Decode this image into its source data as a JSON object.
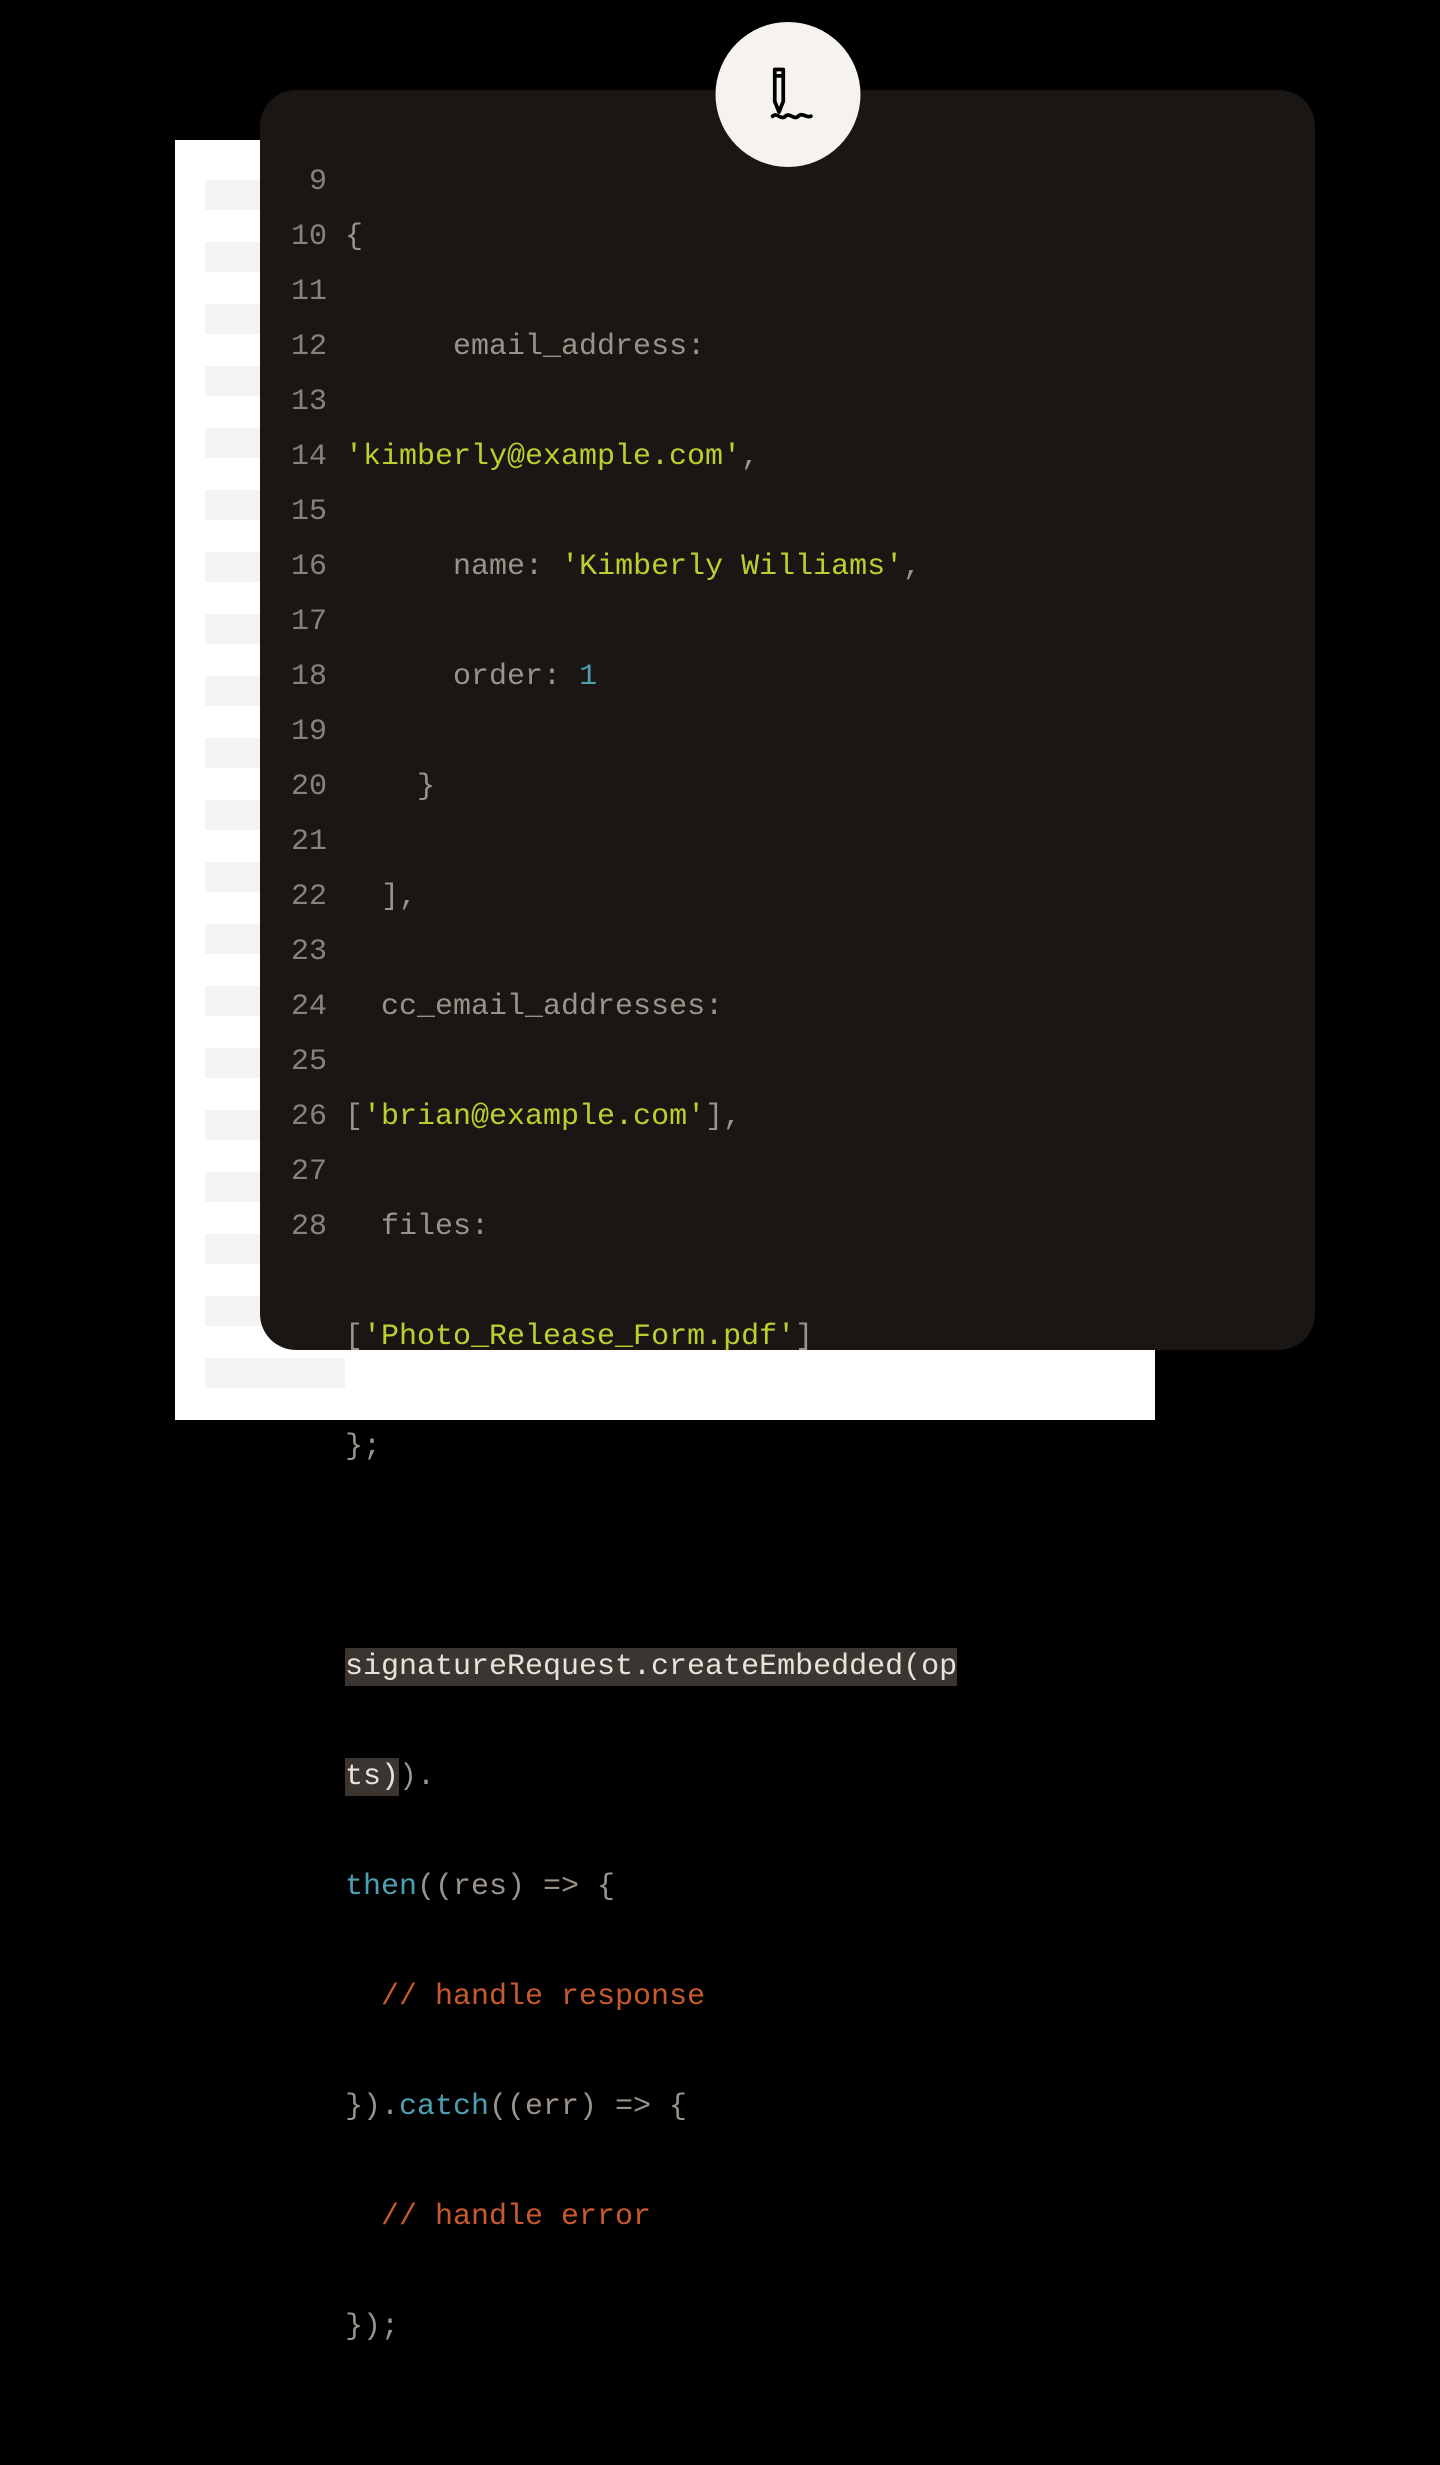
{
  "gutter": {
    "start": 9,
    "end": 28
  },
  "code": {
    "line9": "{",
    "line10_key": "email_address",
    "line11_str": "'kimberly@example.com'",
    "line12_key": "name",
    "line12_str": "'Kimberly Williams'",
    "line13_key": "order",
    "line13_num": "1",
    "line14": "}",
    "line15": "],",
    "line16_key": "cc_email_addresses",
    "line17_str": "'brian@example.com'",
    "line18_key": "files",
    "line19_str": "'Photo_Release_Form.pdf'",
    "line20": "};",
    "line22_hl": "signatureRequest.createEmbedded(op",
    "line23_hl": "ts)",
    "line23_tail": ").",
    "line24_call": "then",
    "line24_rest": "((res) => {",
    "line25_comment": "// handle response",
    "line26_a": "}).",
    "line26_call": "catch",
    "line26_rest": "((err) => {",
    "line27_comment": "// handle error",
    "line28": "});"
  },
  "icon": {
    "name": "signature-pen-icon"
  }
}
